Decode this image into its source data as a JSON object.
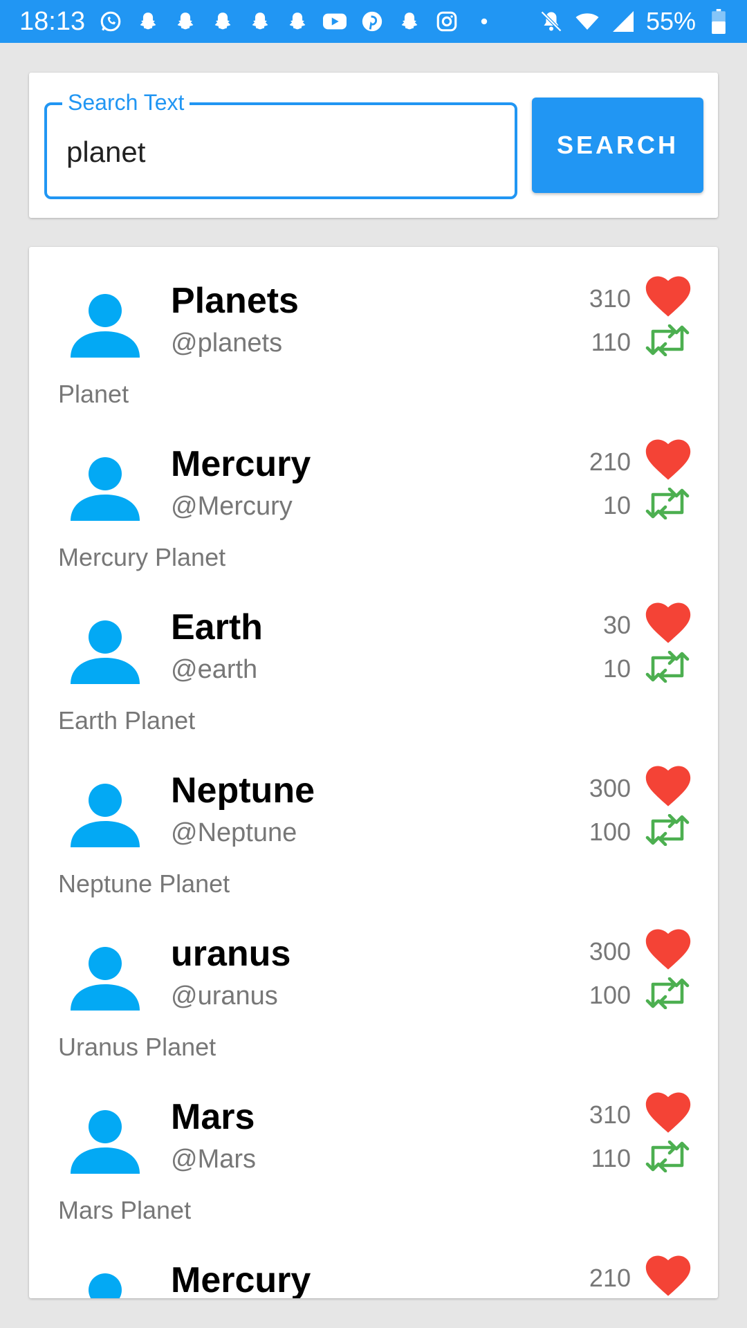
{
  "status_bar": {
    "time": "18:13",
    "battery": "55%",
    "icons": [
      "whatsapp-icon",
      "snapchat-icon",
      "snapchat-icon",
      "snapchat-icon",
      "snapchat-icon",
      "snapchat-icon",
      "youtube-icon",
      "pinterest-icon",
      "snapchat-icon",
      "instagram-icon",
      "dot-icon"
    ]
  },
  "search": {
    "label": "Search Text",
    "value": "planet",
    "button_label": "SEARCH"
  },
  "colors": {
    "accent": "#2196f3",
    "heart": "#f44336",
    "retweet": "#4caf50",
    "avatar": "#03a9f4"
  },
  "results": [
    {
      "name": "Planets",
      "handle": "@planets",
      "description": "Planet",
      "likes": "310",
      "retweets": "110"
    },
    {
      "name": "Mercury",
      "handle": "@Mercury",
      "description": "Mercury Planet",
      "likes": "210",
      "retweets": "10"
    },
    {
      "name": "Earth",
      "handle": "@earth",
      "description": "Earth Planet",
      "likes": "30",
      "retweets": "10"
    },
    {
      "name": "Neptune",
      "handle": "@Neptune",
      "description": "Neptune Planet",
      "likes": "300",
      "retweets": "100"
    },
    {
      "name": "uranus",
      "handle": "@uranus",
      "description": "Uranus Planet",
      "likes": "300",
      "retweets": "100"
    },
    {
      "name": "Mars",
      "handle": "@Mars",
      "description": "Mars Planet",
      "likes": "310",
      "retweets": "110"
    },
    {
      "name": "Mercury",
      "handle": "",
      "description": "",
      "likes": "210",
      "retweets": ""
    }
  ]
}
